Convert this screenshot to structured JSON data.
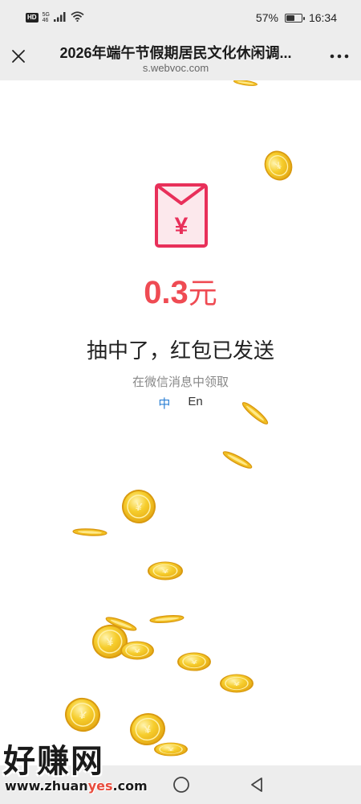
{
  "status_bar": {
    "hd": "HD",
    "signal_label_top": "5G",
    "signal_label_bottom": "46",
    "battery_percent": "57%",
    "battery_level": 0.57,
    "time": "16:34"
  },
  "title_bar": {
    "title": "2026年端午节假期居民文化休闲调...",
    "domain": "s.webvoc.com"
  },
  "result": {
    "amount": "0.3",
    "unit": "元",
    "message": "抽中了，红包已发送",
    "sub_message": "在微信消息中领取",
    "lang_zh": "中",
    "lang_en": "En",
    "currency_symbol": "¥"
  },
  "watermark": {
    "logo": "好赚网",
    "url_prefix": "www.zhuan",
    "url_highlight": "yes",
    "url_suffix": ".com"
  },
  "colors": {
    "accent_red": "#ef4b53",
    "lang_active": "#2a7fd4",
    "coin_gold": "#f3c425"
  }
}
